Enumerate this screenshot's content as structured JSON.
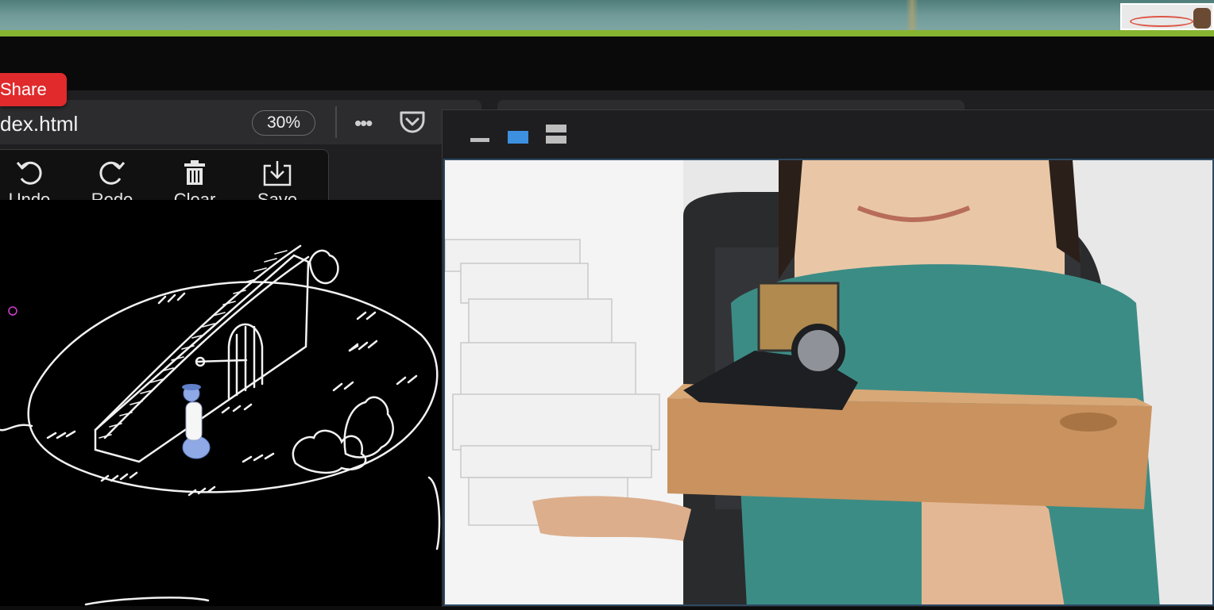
{
  "desktop": {
    "accent_color": "#86b431"
  },
  "share": {
    "label": "Share"
  },
  "browser": {
    "url_text": "dex.html",
    "zoom": "30%",
    "menu_icon": "more-dots-icon",
    "pocket_icon": "pocket-icon"
  },
  "toolbar": {
    "items": [
      {
        "label": "Undo",
        "icon": "undo-icon"
      },
      {
        "label": "Redo",
        "icon": "redo-icon"
      },
      {
        "label": "Clear",
        "icon": "trash-icon"
      },
      {
        "label": "Save",
        "icon": "save-download-icon"
      }
    ]
  },
  "video_window": {
    "layout_buttons": [
      "minimize-icon",
      "single-view-icon",
      "stacked-view-icon"
    ],
    "active_color": "#3d8fe0"
  }
}
